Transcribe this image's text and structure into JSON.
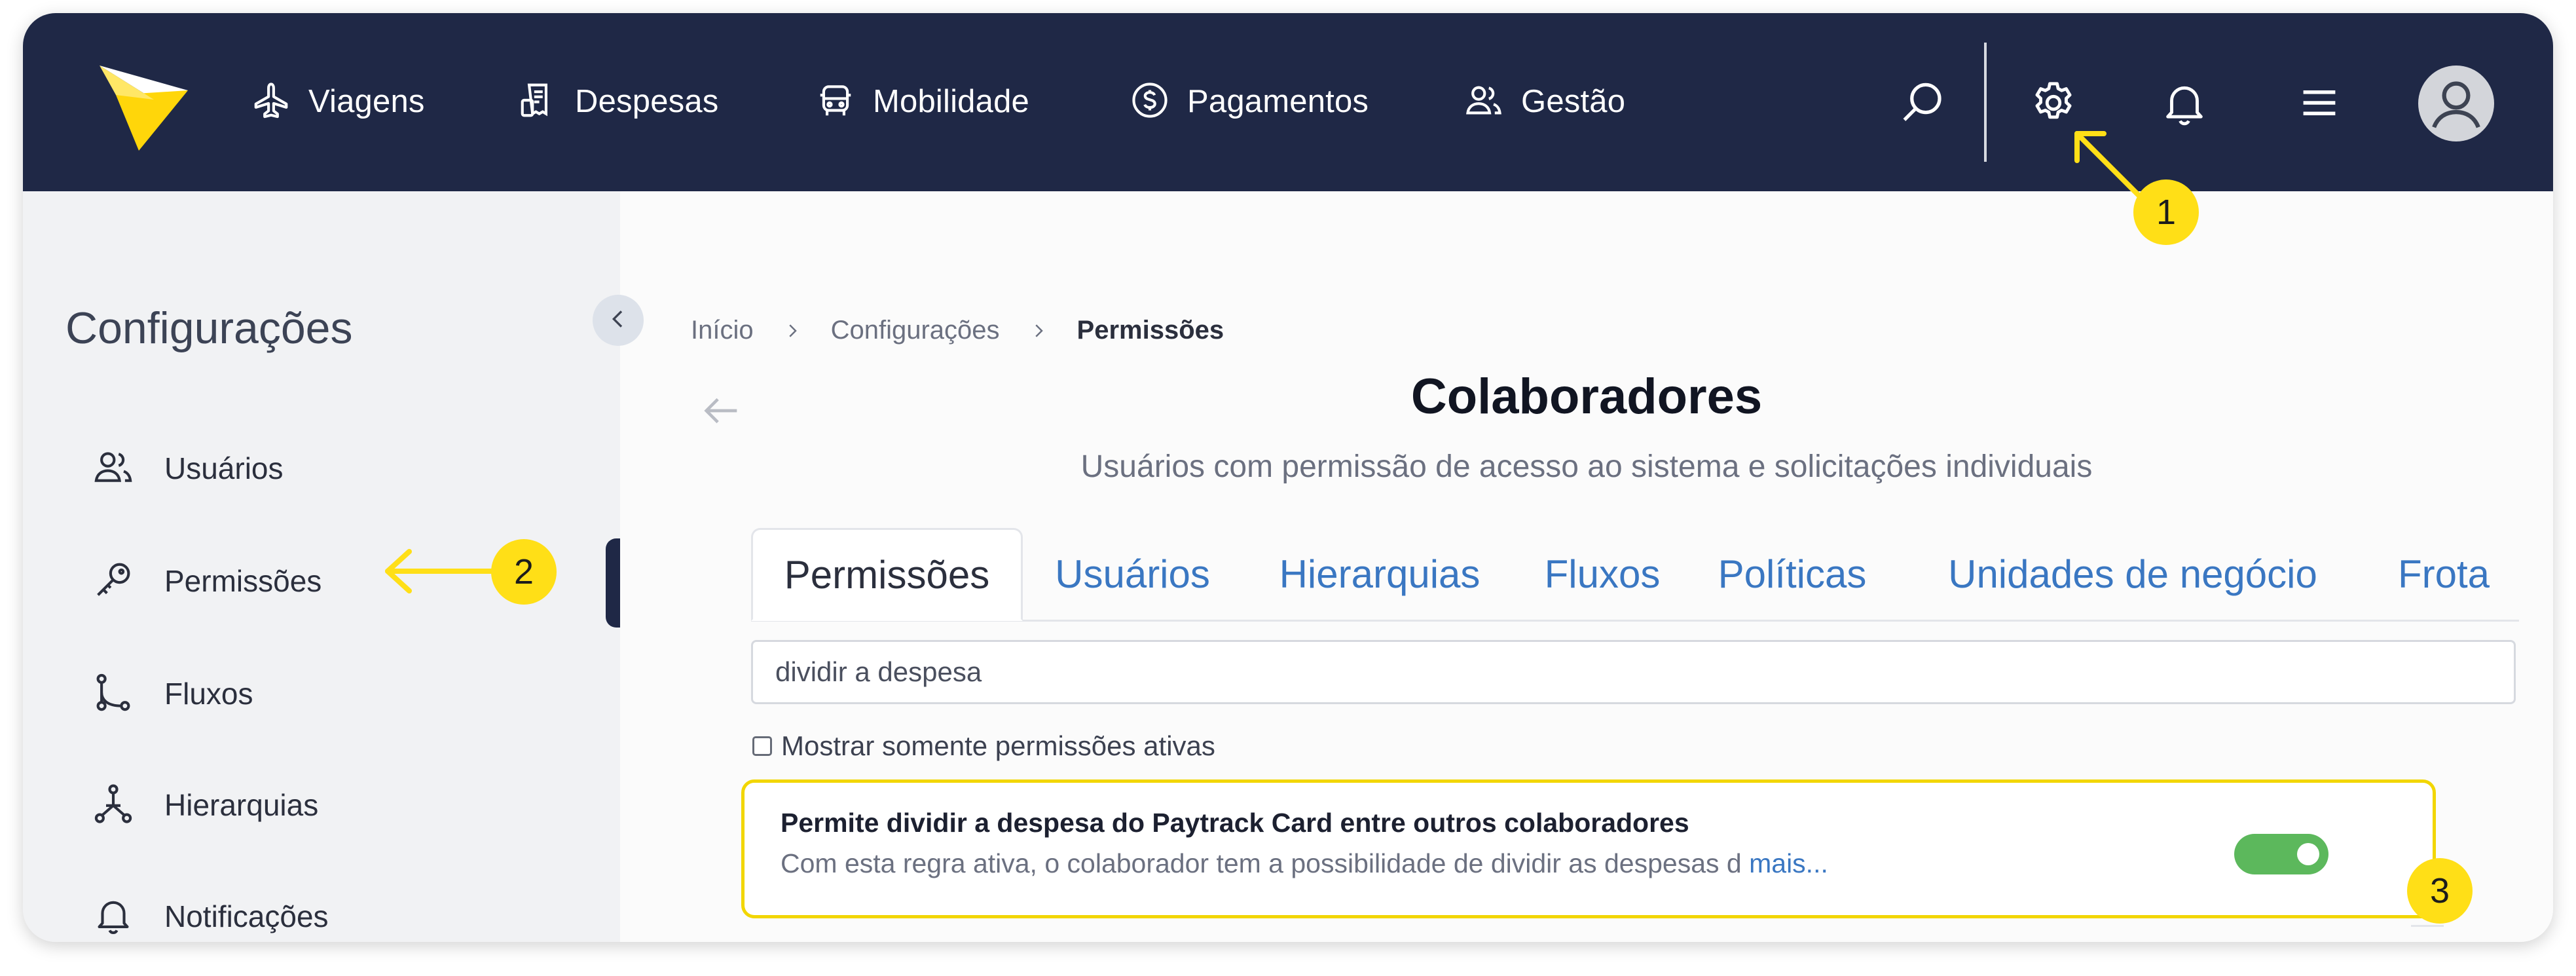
{
  "topbar": {
    "nav": [
      {
        "label": "Viagens",
        "icon": "plane-icon"
      },
      {
        "label": "Despesas",
        "icon": "receipt-icon"
      },
      {
        "label": "Mobilidade",
        "icon": "car-icon"
      },
      {
        "label": "Pagamentos",
        "icon": "dollar-coin-icon"
      },
      {
        "label": "Gestão",
        "icon": "users-icon"
      }
    ],
    "icons": [
      "search-icon",
      "gear-icon",
      "bell-icon",
      "menu-icon",
      "user-avatar-icon"
    ]
  },
  "sidebar": {
    "title": "Configurações",
    "items": [
      {
        "label": "Usuários",
        "icon": "users-icon"
      },
      {
        "label": "Permissões",
        "icon": "key-icon",
        "active": true
      },
      {
        "label": "Fluxos",
        "icon": "flow-icon"
      },
      {
        "label": "Hierarquias",
        "icon": "hierarchy-icon"
      },
      {
        "label": "Notificações",
        "icon": "bell-icon"
      }
    ]
  },
  "breadcrumb": [
    "Início",
    "Configurações",
    "Permissões"
  ],
  "main": {
    "title": "Colaboradores",
    "subtitle": "Usuários com permissão de acesso ao sistema e solicitações individuais",
    "tabs": [
      {
        "label": "Permissões",
        "active": true
      },
      {
        "label": "Usuários"
      },
      {
        "label": "Hierarquias"
      },
      {
        "label": "Fluxos"
      },
      {
        "label": "Políticas"
      },
      {
        "label": "Unidades de negócio"
      },
      {
        "label": "Frota"
      }
    ],
    "search_value": "dividir a despesa",
    "checkbox_label": "Mostrar somente permissões ativas",
    "checkbox_checked": false,
    "permission": {
      "title": "Permite dividir a despesa do Paytrack Card entre outros colaboradores",
      "description": "Com esta regra ativa, o colaborador tem a possibilidade de dividir as despesas d",
      "more_link": "mais...",
      "enabled": true
    }
  },
  "annotations": [
    {
      "number": "1"
    },
    {
      "number": "2"
    },
    {
      "number": "3"
    }
  ],
  "colors": {
    "topbar_bg": "#1f2846",
    "logo_yellow": "#ffd60a",
    "accent_link": "#3a77c2",
    "toggle_on": "#5cb85c",
    "highlight_yellow": "#ffdf17"
  }
}
